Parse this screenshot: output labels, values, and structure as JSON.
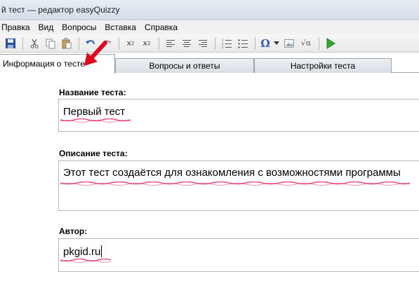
{
  "window": {
    "title": "й тест — редактор easyQuizzy"
  },
  "menu": {
    "items": [
      "Правка",
      "Вид",
      "Вопросы",
      "Вставка",
      "Справка"
    ]
  },
  "toolbar": {
    "icons": [
      "save-icon",
      "cut-icon",
      "copy-icon",
      "paste-icon",
      "undo-icon",
      "redo-icon",
      "superscript-icon",
      "subscript-icon",
      "align-left-icon",
      "align-center-icon",
      "align-right-icon",
      "numbered-list-icon",
      "bullet-list-icon",
      "omega-symbol-icon",
      "insert-image-icon",
      "formula-icon",
      "run-icon"
    ],
    "superscript_label": "x",
    "subscript_label": "x",
    "omega_label": "Ω",
    "formula_label": "√α"
  },
  "tabs": [
    {
      "label": "Информация о тесте",
      "active": true
    },
    {
      "label": "Вопросы и ответы",
      "active": false
    },
    {
      "label": "Настройки теста",
      "active": false
    }
  ],
  "form": {
    "name_label": "Название теста:",
    "name_value": "Первый тест",
    "description_label": "Описание теста:",
    "description_value": "Этот тест создаётся для ознакомления с возможностями программы",
    "author_label": "Автор:",
    "author_value": "pkgid.ru"
  },
  "colors": {
    "annotation_arrow": "#e0001a",
    "highlight_underline": "#e0296e"
  }
}
